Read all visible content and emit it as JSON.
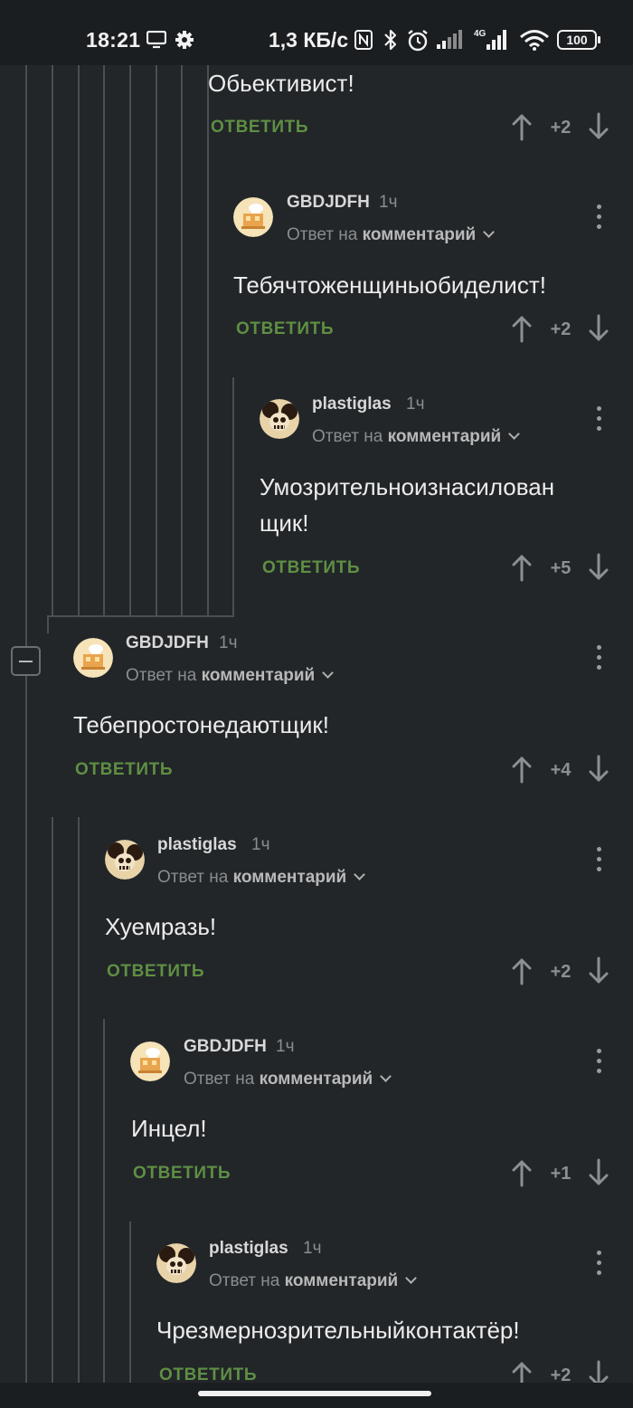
{
  "status_bar": {
    "time": "18:21",
    "network_speed": "1,3 КБ/с",
    "battery": "100",
    "icons": [
      "screen-cast-icon",
      "gear-icon",
      "nfc-icon",
      "bluetooth-icon",
      "alarm-icon",
      "signal-icon",
      "signal-4g-icon",
      "wifi-icon",
      "battery-icon"
    ]
  },
  "ui": {
    "reply_label": "ОТВЕТИТЬ",
    "reply_to_prefix": "Ответ на",
    "reply_to_target": "комментарий"
  },
  "comments": [
    {
      "author": "",
      "time": "",
      "text": "Обьективист!",
      "score": "+2"
    },
    {
      "author": "GBDJDFH",
      "time": "1ч",
      "text": "Тебячтоженщиныобиделист!",
      "score": "+2"
    },
    {
      "author": "plastiglas",
      "time": "1ч",
      "text_line1": "Умозрительноизнасилован",
      "text_line2": "щик!",
      "score": "+5"
    },
    {
      "author": "GBDJDFH",
      "time": "1ч",
      "text": "Тебепростонедаютщик!",
      "score": "+4"
    },
    {
      "author": "plastiglas",
      "time": "1ч",
      "text": "Хуемразь!",
      "score": "+2"
    },
    {
      "author": "GBDJDFH",
      "time": "1ч",
      "text": "Инцел!",
      "score": "+1"
    },
    {
      "author": "plastiglas",
      "time": "1ч",
      "text": "Чрезмернозрительныйконтактёр!",
      "score": "+2"
    }
  ],
  "colors": {
    "background": "#222629",
    "reply_green": "#5f8f43",
    "thread_line": "#4a4f54"
  }
}
